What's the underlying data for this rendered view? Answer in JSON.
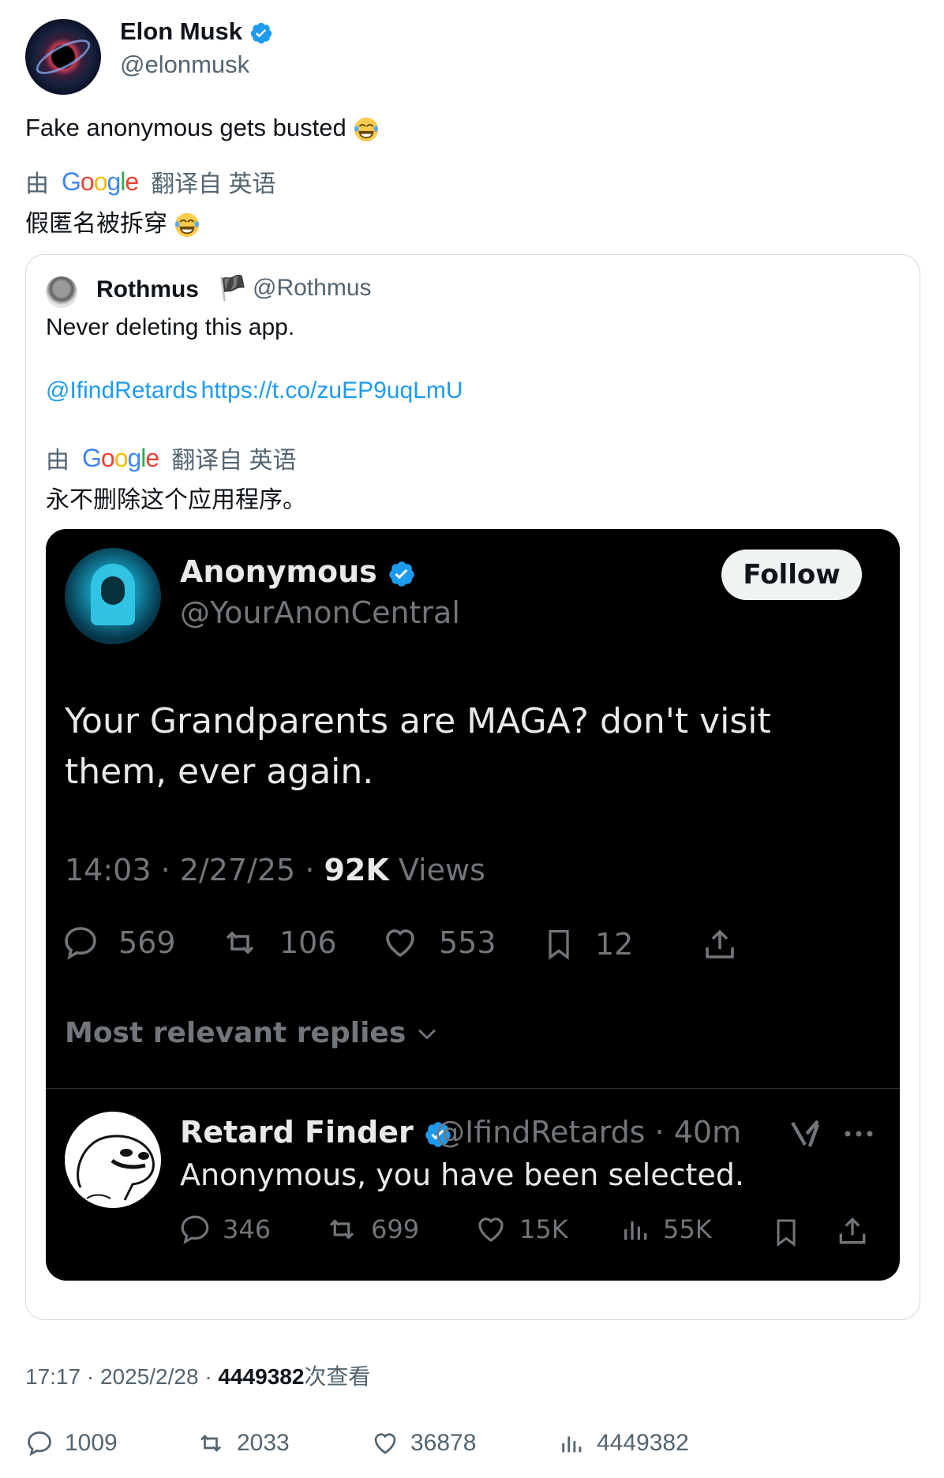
{
  "author": {
    "name": "Elon Musk",
    "handle": "@elonmusk"
  },
  "tweet": {
    "text": "Fake anonymous gets busted",
    "translate_by": "由",
    "translate_from": "翻译自 英语",
    "translated_text": "假匿名被拆穿"
  },
  "quote": {
    "name": "Rothmus",
    "flag": "🏴",
    "handle": "@Rothmus",
    "text": "Never deleting this app.",
    "mention": "@IfindRetards",
    "link": "https://t.co/zuEP9uqLmU",
    "translate_by": "由",
    "translate_from": "翻译自 英语",
    "translated_text": "永不删除这个应用程序。"
  },
  "embedded": {
    "name": "Anonymous",
    "handle": "@YourAnonCentral",
    "follow_label": "Follow",
    "text": "Your Grandparents are MAGA? don't visit them, ever again.",
    "time": "14:03 · 2/27/25 · ",
    "views_count": "92K",
    "views_label": " Views",
    "stats": {
      "replies": "569",
      "reposts": "106",
      "likes": "553",
      "bookmarks": "12"
    },
    "replies_toggle": "Most relevant replies",
    "reply": {
      "name": "Retard Finder",
      "handle": "@IfindRetards · 40m",
      "text": "Anonymous, you have been selected.",
      "stats": {
        "replies": "346",
        "reposts": "699",
        "likes": "15K",
        "views": "55K"
      }
    }
  },
  "footer": {
    "time": "17:17 · 2025/2/28 · ",
    "views_count": "4449382",
    "views_label": "次查看",
    "stats": {
      "replies": "1009",
      "reposts": "2033",
      "likes": "36878",
      "views": "4449382"
    }
  },
  "colors": {
    "verified": "#1d9bf0",
    "link": "#1d9bf0",
    "muted": "#536471",
    "dark_bg": "#000000"
  },
  "google_logo": "Google"
}
